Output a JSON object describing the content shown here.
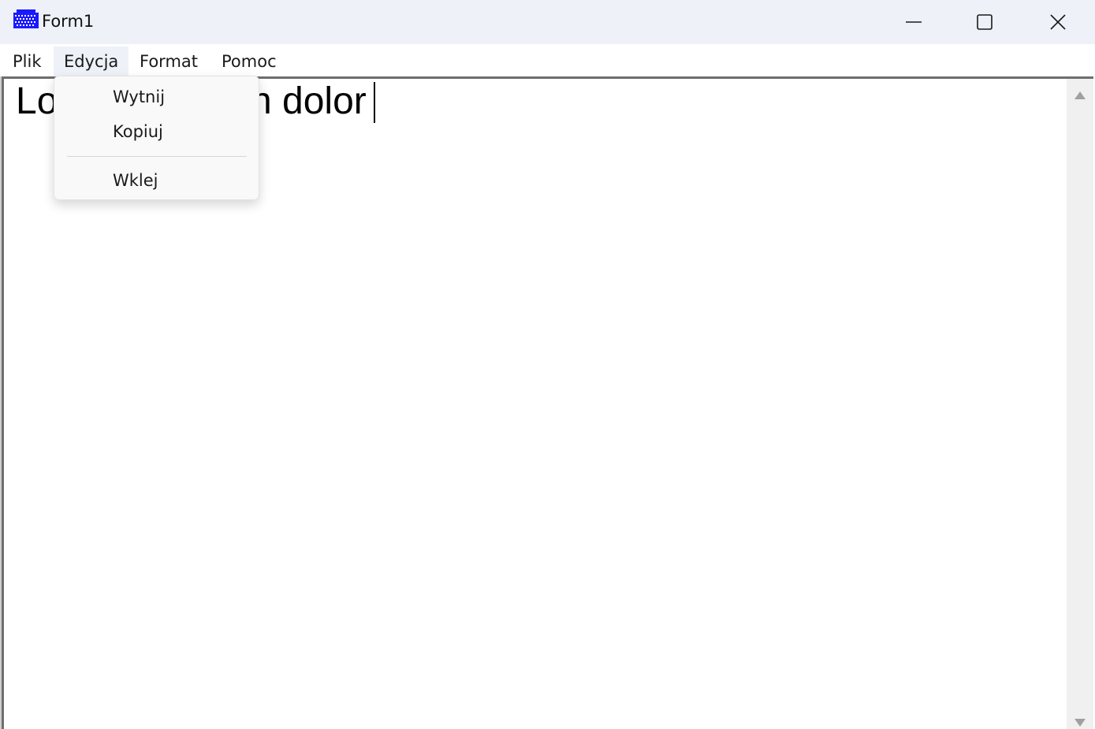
{
  "window": {
    "title": "Form1",
    "app_icon": "grid-app-icon",
    "controls": {
      "minimize": "minimize-icon",
      "maximize": "maximize-icon",
      "close": "close-icon"
    }
  },
  "menubar": {
    "items": [
      {
        "label": "Plik"
      },
      {
        "label": "Edycja"
      },
      {
        "label": "Format"
      },
      {
        "label": "Pomoc"
      }
    ],
    "active": "Edycja"
  },
  "editor": {
    "visible_left": "Lo",
    "visible_right": "n dolor"
  },
  "dropdown": {
    "items": [
      {
        "label": "Wytnij"
      },
      {
        "label": "Kopiuj"
      },
      {
        "label": "Wklej"
      }
    ]
  },
  "scrollbar": {
    "up_icon": "scroll-up-arrow-icon",
    "down_icon": "scroll-down-arrow-icon"
  },
  "colors": {
    "titlebar_bg": "#eef1f7",
    "menu_active_bg": "#eef1f7",
    "dropdown_bg": "#f9f9f9",
    "scrollbar_bg": "#f0f0f0",
    "icon_blue": "#1a1aff"
  }
}
